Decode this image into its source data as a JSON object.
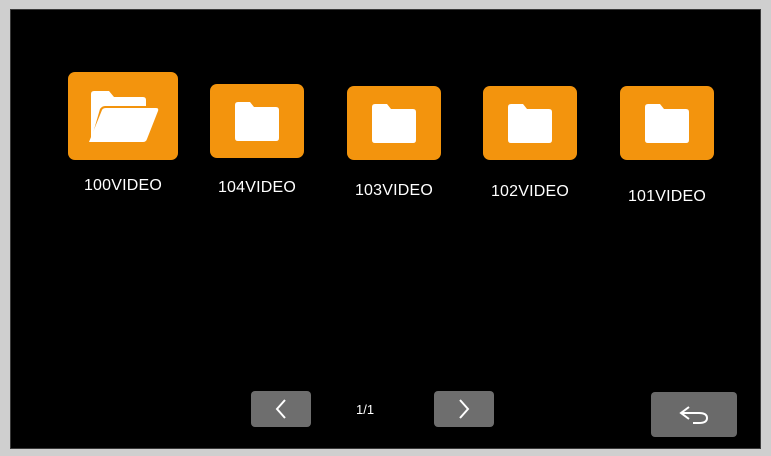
{
  "folders": [
    {
      "name": "100VIDEO",
      "icon": "folder-open-icon",
      "selected": true
    },
    {
      "name": "104VIDEO",
      "icon": "folder-icon",
      "selected": false
    },
    {
      "name": "103VIDEO",
      "icon": "folder-icon",
      "selected": false
    },
    {
      "name": "102VIDEO",
      "icon": "folder-icon",
      "selected": false
    },
    {
      "name": "101VIDEO",
      "icon": "folder-icon",
      "selected": false
    }
  ],
  "pagination": {
    "page": "1/1",
    "prev_icon": "chevron-left-icon",
    "next_icon": "chevron-right-icon"
  },
  "back_button": {
    "icon": "return-arrow-icon"
  },
  "colors": {
    "accent": "#f3940d",
    "background": "#000000",
    "button": "#6e6e6e"
  }
}
